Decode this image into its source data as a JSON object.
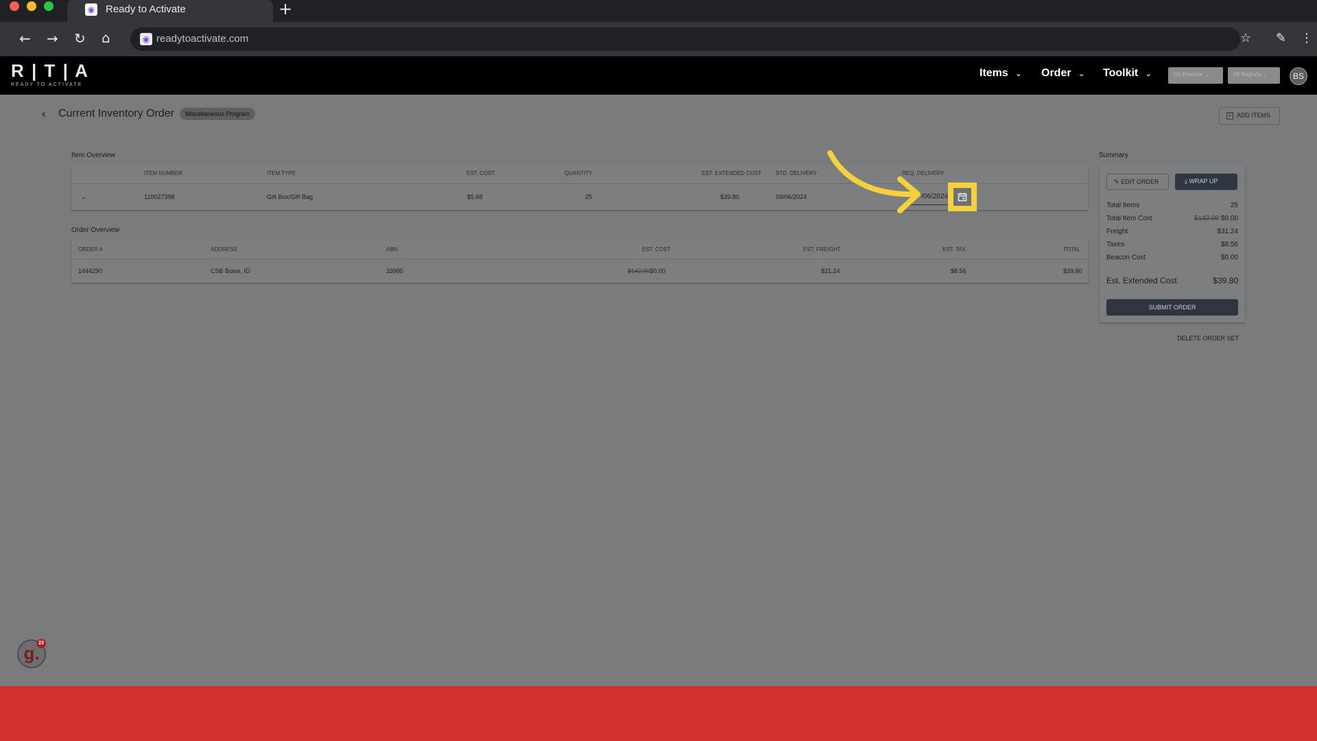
{
  "browser": {
    "tab_title": "Ready to Activate",
    "url": "readytoactivate.com",
    "new_tab_symbol": "+"
  },
  "app": {
    "logo": "R | T | A",
    "logo_subtitle": "READY TO ACTIVATE",
    "menu": [
      {
        "label": "Items"
      },
      {
        "label": "Order"
      },
      {
        "label": "Toolkit"
      }
    ],
    "filters": {
      "premise": "On Premise",
      "regions": "All Regions"
    },
    "avatar_initials": "BS"
  },
  "page": {
    "title": "Current Inventory Order",
    "program_badge": "Miscellaneous Program",
    "add_items_label": "ADD ITEMS"
  },
  "item_overview": {
    "label": "Item Overview",
    "headers": [
      "ITEM NUMBER",
      "ITEM TYPE",
      "EST. COST",
      "QUANTITY",
      "EST. EXTENDED COST",
      "STD. DELIVERY",
      "REQ. DELIVERY"
    ],
    "row": {
      "item_number": "110027398",
      "item_type": "Gift Box/Gift Bag",
      "est_cost": "$5.68",
      "quantity": "25",
      "est_extended_cost": "$39.80",
      "std_delivery": "09/06/2024",
      "req_delivery": "/06/2024"
    }
  },
  "order_overview": {
    "label": "Order Overview",
    "headers": [
      "ORDER #",
      "ADDRESS",
      "ABN",
      "EST. COST",
      "EST. FREIGHT",
      "EST. TAX",
      "TOTAL"
    ],
    "row": {
      "order_number": "1444290",
      "address": "CSB Boise, ID",
      "abn": "33995",
      "est_cost_old": "$142.00",
      "est_cost": "$0.00",
      "est_freight": "$31.24",
      "est_tax": "$8.56",
      "total": "$39.80"
    }
  },
  "summary": {
    "title": "Summary",
    "edit_label": "EDIT ORDER",
    "wrap_label": "WRAP UP",
    "rows": [
      {
        "label": "Total Items",
        "value": "25"
      },
      {
        "label": "Total Item Cost",
        "old": "$142.00",
        "value": "$0.00"
      },
      {
        "label": "Freight",
        "value": "$31.24"
      },
      {
        "label": "Taxes",
        "value": "$8.56"
      },
      {
        "label": "Beacon Cost",
        "value": "$0.00"
      }
    ],
    "extended_label": "Est. Extended Cost",
    "extended_value": "$39.80",
    "submit_label": "SUBMIT ORDER",
    "delete_label": "DELETE ORDER SET"
  },
  "widget": {
    "letter": "g.",
    "count": "23"
  },
  "colors": {
    "highlight": "#f5d23c",
    "bottom_bar": "#d22f2f",
    "dark_button": "#2f3642"
  }
}
